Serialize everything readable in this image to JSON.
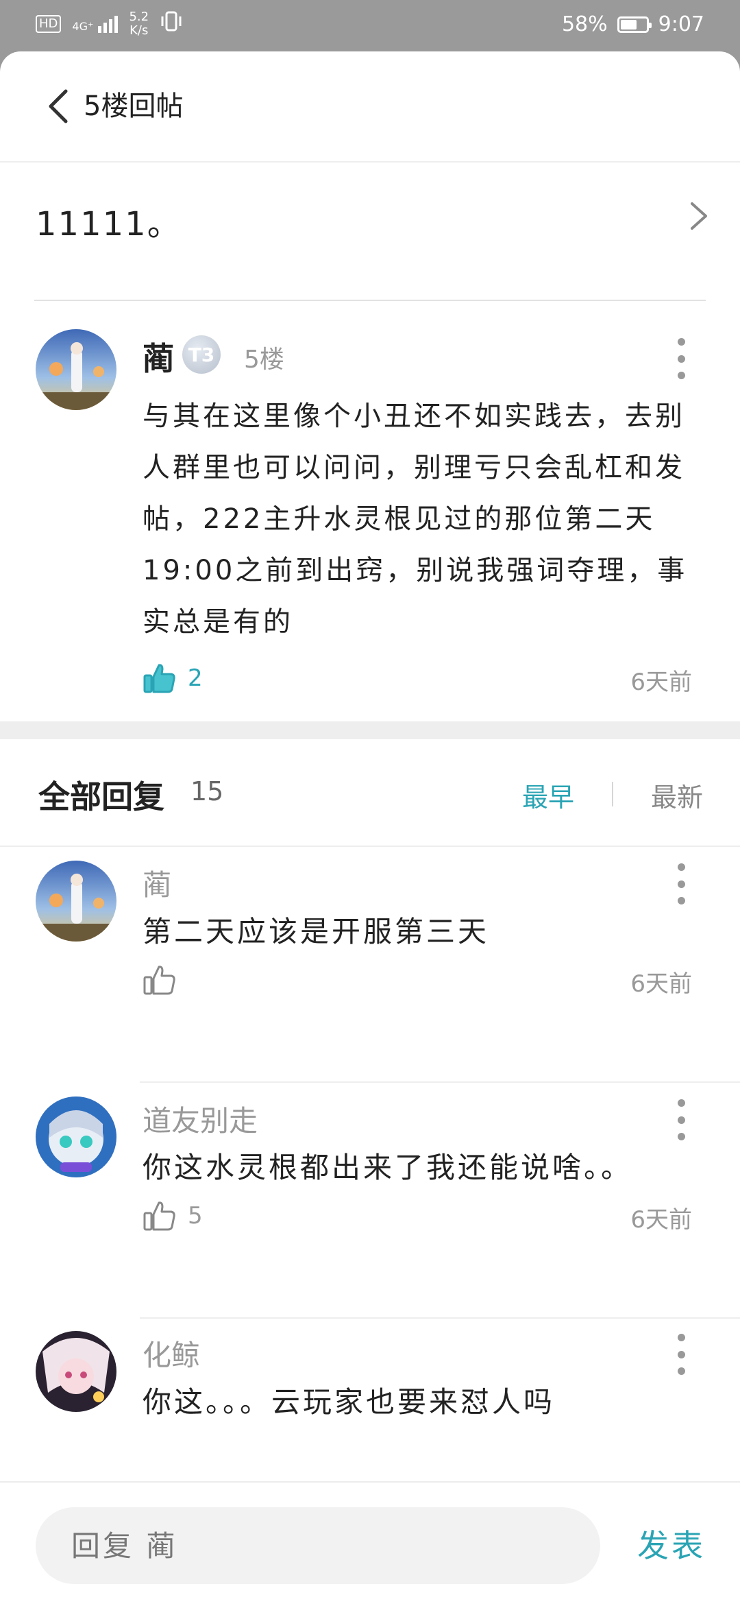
{
  "status_bar": {
    "hd": "HD",
    "network": "4G⁺",
    "speed_value": "5.2",
    "speed_unit": "K/s",
    "battery": "58%",
    "battery_level": 0.58,
    "time": "9:07"
  },
  "header": {
    "title": "5楼回帖"
  },
  "quote": {
    "text": "11111。"
  },
  "post": {
    "author": "蔺",
    "level_badge": "T3",
    "floor": "5楼",
    "content": "与其在这里像个小丑还不如实践去，去别人群里也可以问问，别理亏只会乱杠和发帖，222主升水灵根见过的那位第二天19:00之前到出窍，别说我强词夺理，事实总是有的",
    "likes": "2",
    "time": "6天前"
  },
  "replies_header": {
    "title": "全部回复",
    "count": "15",
    "sort_earliest": "最早",
    "sort_latest": "最新"
  },
  "replies": [
    {
      "name": "蔺",
      "text": "第二天应该是开服第三天",
      "likes": "",
      "time": "6天前"
    },
    {
      "name": "道友别走",
      "text": "你这水灵根都出来了我还能说啥。。",
      "likes": "5",
      "time": "6天前"
    },
    {
      "name": "化鲸",
      "text": "你这。。。云玩家也要来怼人吗",
      "likes": "",
      "time": ""
    }
  ],
  "bottom": {
    "placeholder": "回复 蔺",
    "send_label": "发表"
  },
  "colors": {
    "accent": "#2aa4b4",
    "status_bar": "#9a9a9a",
    "separator": "#eeeeee"
  },
  "icons": [
    "chevron-left-icon",
    "chevron-right-icon",
    "more-vertical-icon",
    "thumbs-up-icon",
    "thumbs-up-filled-icon",
    "battery-icon",
    "signal-icon",
    "vibrate-icon"
  ]
}
